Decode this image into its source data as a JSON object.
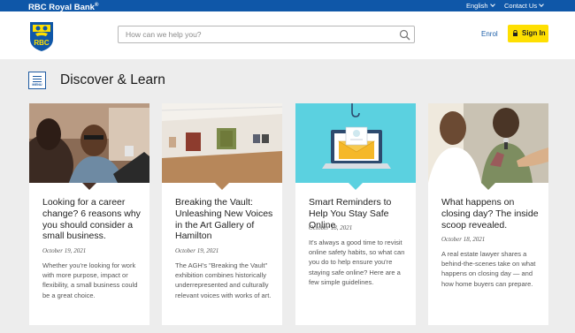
{
  "brand": {
    "name": "RBC Royal Bank",
    "mark": "®"
  },
  "utility": {
    "language": "English",
    "contact": "Contact Us"
  },
  "header": {
    "logo_text": "RBC",
    "search_placeholder": "How can we help you?",
    "enrol": "Enrol",
    "sign_in": "Sign In"
  },
  "page": {
    "menu_label": "MENU",
    "title": "Discover & Learn"
  },
  "colors": {
    "brand_blue": "#0f57a8",
    "sign_in_yellow": "#fedf01",
    "background": "#ededed"
  },
  "cards": [
    {
      "title": "Looking for a career change? 6 reasons why you should consider a small business.",
      "date": "October 19, 2021",
      "description": "Whether you're looking for work with more purpose, impact or flexibility, a small business could be a great choice."
    },
    {
      "title": "Breaking the Vault: Unleashing New Voices in the Art Gallery of Hamilton",
      "date": "October 19, 2021",
      "description": "The AGH's \"Breaking the Vault\" exhibition combines historically underrepresented and culturally relevant voices with works of art."
    },
    {
      "title": "Smart Reminders to Help You Stay Safe Online",
      "date": "October 18, 2021",
      "description": "It's always a good time to revisit online safety habits, so what can you do to help ensure you're staying safe online? Here are a few simple guidelines."
    },
    {
      "title": "What happens on closing day? The inside scoop revealed.",
      "date": "October 18, 2021",
      "description": "A real estate lawyer shares a behind-the-scenes take on what happens on closing day — and how home buyers can prepare."
    }
  ]
}
